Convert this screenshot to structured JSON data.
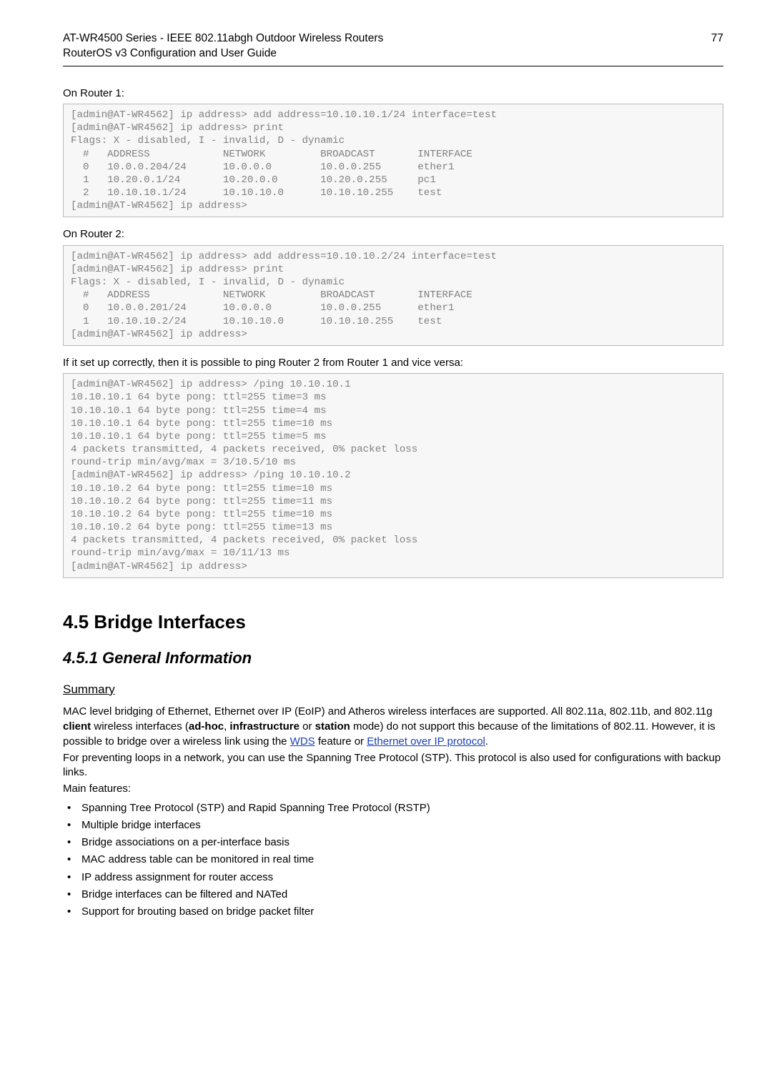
{
  "header": {
    "line1": "AT-WR4500 Series - IEEE 802.11abgh Outdoor Wireless Routers",
    "line2": "RouterOS v3 Configuration and User Guide",
    "page_number": "77"
  },
  "block1": {
    "label": "On Router 1:",
    "code": "[admin@AT-WR4562] ip address> add address=10.10.10.1/24 interface=test\n[admin@AT-WR4562] ip address> print\nFlags: X - disabled, I - invalid, D - dynamic\n  #   ADDRESS            NETWORK         BROADCAST       INTERFACE\n  0   10.0.0.204/24      10.0.0.0        10.0.0.255      ether1\n  1   10.20.0.1/24       10.20.0.0       10.20.0.255     pc1\n  2   10.10.10.1/24      10.10.10.0      10.10.10.255    test\n[admin@AT-WR4562] ip address>"
  },
  "block2": {
    "label": "On Router 2:",
    "code": "[admin@AT-WR4562] ip address> add address=10.10.10.2/24 interface=test\n[admin@AT-WR4562] ip address> print\nFlags: X - disabled, I - invalid, D - dynamic\n  #   ADDRESS            NETWORK         BROADCAST       INTERFACE\n  0   10.0.0.201/24      10.0.0.0        10.0.0.255      ether1\n  1   10.10.10.2/24      10.10.10.0      10.10.10.255    test\n[admin@AT-WR4562] ip address>"
  },
  "block3": {
    "label": "If it set up correctly, then it is possible to ping Router 2 from Router 1 and vice versa:",
    "code": "[admin@AT-WR4562] ip address> /ping 10.10.10.1\n10.10.10.1 64 byte pong: ttl=255 time=3 ms\n10.10.10.1 64 byte pong: ttl=255 time=4 ms\n10.10.10.1 64 byte pong: ttl=255 time=10 ms\n10.10.10.1 64 byte pong: ttl=255 time=5 ms\n4 packets transmitted, 4 packets received, 0% packet loss\nround-trip min/avg/max = 3/10.5/10 ms\n[admin@AT-WR4562] ip address> /ping 10.10.10.2\n10.10.10.2 64 byte pong: ttl=255 time=10 ms\n10.10.10.2 64 byte pong: ttl=255 time=11 ms\n10.10.10.2 64 byte pong: ttl=255 time=10 ms\n10.10.10.2 64 byte pong: ttl=255 time=13 ms\n4 packets transmitted, 4 packets received, 0% packet loss\nround-trip min/avg/max = 10/11/13 ms\n[admin@AT-WR4562] ip address>"
  },
  "section": {
    "title": "4.5 Bridge Interfaces",
    "subtitle": "4.5.1 General Information",
    "summary_head": "Summary",
    "paragraphs": {
      "p1a": "MAC level bridging of Ethernet, Ethernet over IP (EoIP) and Atheros wireless interfaces are supported. All 802.11a, 802.11b, and 802.11g ",
      "p1b_bold": "client",
      "p1c": " wireless interfaces (",
      "p1d_bold": "ad-hoc",
      "p1e": ", ",
      "p1f_bold": "infrastructure",
      "p1g": " or ",
      "p1h_bold": "station",
      "p1i": " mode) do not support this because of the limitations of 802.11. However, it is possible to bridge over a wireless link using the ",
      "link1": "WDS",
      "p1j": " feature or ",
      "link2": "Ethernet over IP protocol",
      "p1k": ".",
      "p2": "For preventing loops in a network, you can use the Spanning Tree Protocol (STP). This protocol is also used for configurations with backup links.",
      "p3": "Main features:"
    },
    "bullets": [
      "Spanning Tree Protocol (STP) and Rapid Spanning Tree Protocol (RSTP)",
      "Multiple bridge interfaces",
      "Bridge associations on a per-interface basis",
      "MAC address table can be monitored in real time",
      "IP address assignment for router access",
      "Bridge interfaces can be filtered and NATed",
      "Support for brouting based on bridge packet filter"
    ]
  }
}
